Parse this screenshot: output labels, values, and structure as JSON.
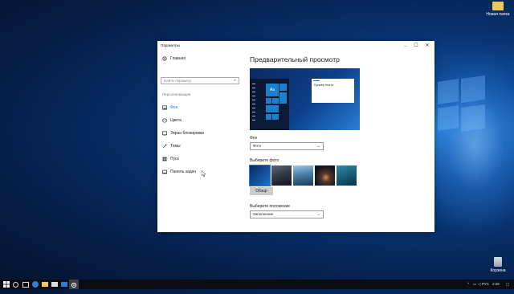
{
  "desktop": {
    "icons": [
      {
        "label": "Новая папка"
      },
      {
        "label": "Корзина"
      }
    ]
  },
  "window": {
    "title": "Параметры",
    "controls": {
      "minimize": "—",
      "maximize": "☐",
      "close": "✕"
    },
    "sidebar": {
      "home": "Главная",
      "search_placeholder": "Найти параметр",
      "section": "Персонализация",
      "items": [
        {
          "label": "Фон",
          "icon": "image-icon",
          "active": true
        },
        {
          "label": "Цвета",
          "icon": "palette-icon"
        },
        {
          "label": "Экран блокировки",
          "icon": "lock-screen-icon"
        },
        {
          "label": "Темы",
          "icon": "brush-icon"
        },
        {
          "label": "Пуск",
          "icon": "start-icon"
        },
        {
          "label": "Панель задач",
          "icon": "taskbar-icon"
        }
      ]
    },
    "main": {
      "heading": "Предварительный просмотр",
      "preview": {
        "tile_text": "Aa",
        "window_text": "Пример текста"
      },
      "background_label": "Фон",
      "background_value": "Фото",
      "choose_photo_label": "Выберите фото",
      "browse_button": "Обзор",
      "position_label": "Выберите положение",
      "position_value": "Заполнение"
    }
  },
  "taskbar": {
    "tray": {
      "language": "РУС",
      "time": "2:28"
    }
  },
  "colors": {
    "accent": "#1a80d0",
    "taskbar": "#0b0d12"
  }
}
